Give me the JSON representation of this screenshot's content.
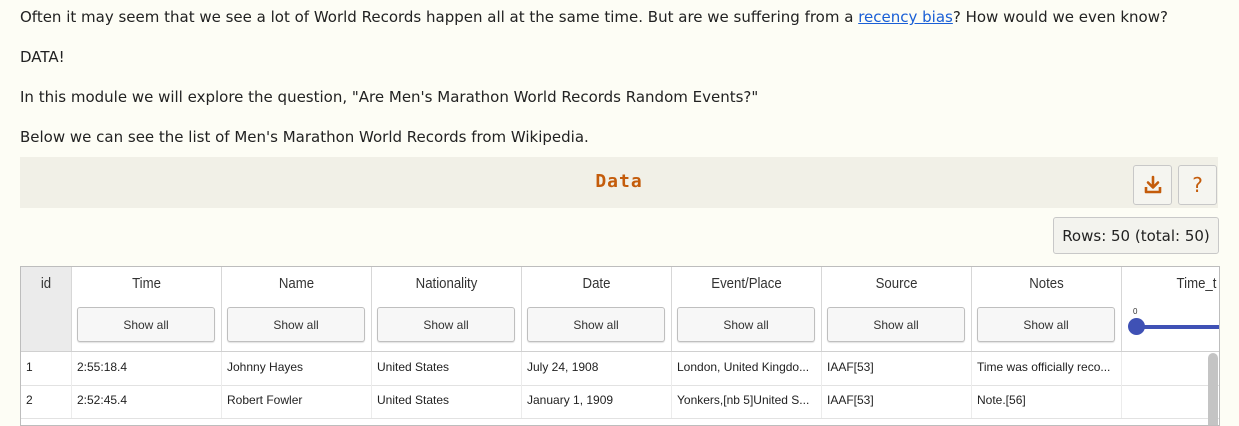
{
  "intro": {
    "p1_before": "Often it may seem that we see a lot of World Records happen all at the same time. But are we suffering from a ",
    "p1_link": "recency bias",
    "p1_after": "? How would we even know?",
    "p2": "DATA!",
    "p3": "In this module we will explore the question, \"Are Men's Marathon World Records Random Events?\"",
    "p4": "Below we can see the list of Men's Marathon World Records from Wikipedia."
  },
  "panel": {
    "title": "Data",
    "download_icon": "download-icon",
    "help_label": "?",
    "rows_label": "Rows: 50 (total: 50)",
    "accent_color": "#c45c0b"
  },
  "table": {
    "columns": [
      {
        "label": "id"
      },
      {
        "label": "Time",
        "filter": "Show all"
      },
      {
        "label": "Name",
        "filter": "Show all"
      },
      {
        "label": "Nationality",
        "filter": "Show all"
      },
      {
        "label": "Date",
        "filter": "Show all"
      },
      {
        "label": "Event/Place",
        "filter": "Show all"
      },
      {
        "label": "Source",
        "filter": "Show all"
      },
      {
        "label": "Notes",
        "filter": "Show all"
      },
      {
        "label": "Time_t",
        "slider_min": "0"
      }
    ],
    "rows": [
      {
        "id": "1",
        "time": "2:55:18.4",
        "name": "Johnny Hayes",
        "nationality": "United States",
        "date": "July 24, 1908",
        "event": "London, United Kingdo...",
        "source": "IAAF[53]",
        "notes": "Time was officially reco...",
        "time_t": ""
      },
      {
        "id": "2",
        "time": "2:52:45.4",
        "name": "Robert Fowler",
        "nationality": "United States",
        "date": "January 1, 1909",
        "event": "Yonkers,[nb 5]United S...",
        "source": "IAAF[53]",
        "notes": "Note.[56]",
        "time_t": ""
      }
    ]
  }
}
